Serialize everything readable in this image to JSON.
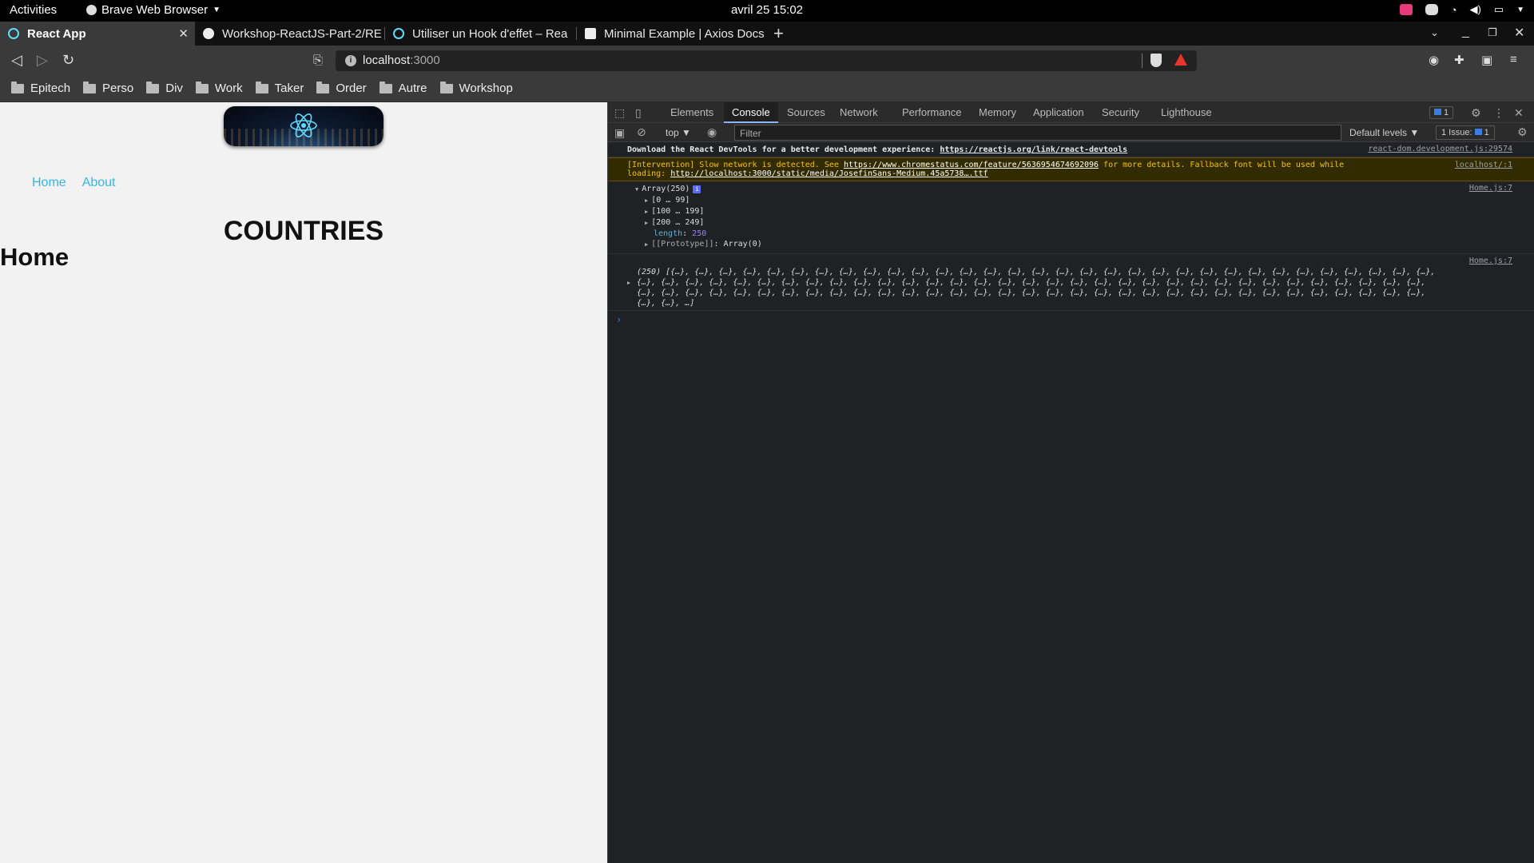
{
  "system_bar": {
    "activities": "Activities",
    "app_name": "Brave Web Browser",
    "datetime": "avril 25  15:02"
  },
  "tabs": [
    {
      "title": "React App",
      "active": true
    },
    {
      "title": "Workshop-ReactJS-Part-2/RE"
    },
    {
      "title": "Utiliser un Hook d'effet – Rea"
    },
    {
      "title": "Minimal Example | Axios Docs"
    }
  ],
  "address_bar": {
    "host": "localhost",
    "port": ":3000"
  },
  "bookmarks": [
    "Epitech",
    "Perso",
    "Div",
    "Work",
    "Taker",
    "Order",
    "Autre",
    "Workshop"
  ],
  "page": {
    "nav": [
      "Home",
      "About"
    ],
    "heading": "COUNTRIES",
    "subheading": "Home"
  },
  "devtools": {
    "tabs": [
      "Elements",
      "Console",
      "Sources",
      "Network",
      "Performance",
      "Memory",
      "Application",
      "Security",
      "Lighthouse"
    ],
    "active_tab": "Console",
    "message_badge": "1",
    "context": "top",
    "filter_placeholder": "Filter",
    "levels": "Default levels",
    "issues": "1 Issue:",
    "issues_count": "1",
    "messages": {
      "devtools_msg": "Download the React DevTools for a better development experience: ",
      "devtools_link": "https://reactjs.org/link/react-devtools",
      "devtools_src": "react-dom.development.js:29574",
      "warn_msg_a": "[Intervention] Slow network is detected. See ",
      "warn_link": "https://www.chromestatus.com/feature/5636954674692096",
      "warn_msg_b": " for more details. Fallback font will be used while",
      "warn_msg_c": "loading: ",
      "warn_link2": "http://localhost:3000/static/media/JosefinSans-Medium.45a5738….ttf",
      "warn_src": "localhost/:1",
      "array_label": "Array(250)",
      "array_src": "Home.js:7",
      "range1": "[0 … 99]",
      "range2": "[100 … 199]",
      "range3": "[200 … 249]",
      "length_key": "length",
      "length_val": "250",
      "proto_key": "[[Prototype]]",
      "proto_val": "Array(0)",
      "obj_src": "Home.js:7",
      "obj_line1": "(250) [{…}, {…}, {…}, {…}, {…}, {…}, {…}, {…}, {…}, {…}, {…}, {…}, {…}, {…}, {…}, {…}, {…}, {…}, {…}, {…}, {…}, {…}, {…}, {…}, {…}, {…}, {…}, {…}, {…}, {…}, {…}, {…},",
      "obj_line2": "{…}, {…}, {…}, {…}, {…}, {…}, {…}, {…}, {…}, {…}, {…}, {…}, {…}, {…}, {…}, {…}, {…}, {…}, {…}, {…}, {…}, {…}, {…}, {…}, {…}, {…}, {…}, {…}, {…}, {…}, {…}, {…}, {…},",
      "obj_line3": "{…}, {…}, {…}, {…}, {…}, {…}, {…}, {…}, {…}, {…}, {…}, {…}, {…}, {…}, {…}, {…}, {…}, {…}, {…}, {…}, {…}, {…}, {…}, {…}, {…}, {…}, {…}, {…}, {…}, {…}, {…}, {…}, {…},",
      "obj_line4": "{…}, {…}, …]"
    }
  }
}
